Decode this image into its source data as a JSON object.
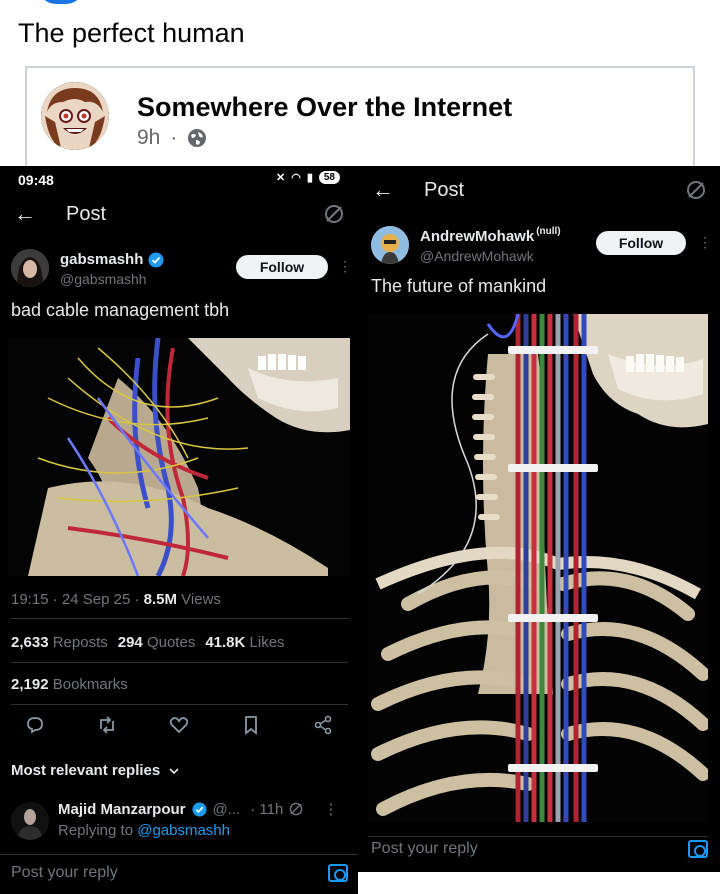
{
  "facebook": {
    "post_text": "The perfect human",
    "shared": {
      "author": "Somewhere Over the Internet",
      "time": "9h",
      "separator": "·",
      "privacy_icon": "globe-icon"
    }
  },
  "left_post": {
    "status": {
      "time": "09:48",
      "battery": "58"
    },
    "header": {
      "title": "Post",
      "back_icon": "arrow-left-icon",
      "grok_icon": "grok-icon"
    },
    "author": {
      "name": "gabsmashh",
      "handle": "@gabsmashh",
      "verified": true
    },
    "follow_label": "Follow",
    "more": "⋮",
    "text": "bad cable management tbh",
    "meta": {
      "time": "19:15",
      "date": "24 Sep 25",
      "views_count": "8.5M",
      "views_label": "Views"
    },
    "stats": {
      "reposts_count": "2,633",
      "reposts_label": "Reposts",
      "quotes_count": "294",
      "quotes_label": "Quotes",
      "likes_count": "41.8K",
      "likes_label": "Likes",
      "bookmarks_count": "2,192",
      "bookmarks_label": "Bookmarks"
    },
    "actions": [
      "reply-icon",
      "repost-icon",
      "like-icon",
      "bookmark-icon",
      "share-icon"
    ],
    "replies_sort": "Most relevant replies",
    "reply": {
      "name": "Majid Manzarpour",
      "handle": "@...",
      "time": "· 11h",
      "replying_prefix": "Replying to",
      "replying_to": "@gabsmashh"
    },
    "reply_placeholder": "Post your reply"
  },
  "right_post": {
    "header": {
      "title": "Post"
    },
    "author": {
      "name": "AndrewMohawk",
      "suffix": "(null)",
      "handle": "@AndrewMohawk"
    },
    "follow_label": "Follow",
    "more": "⋮",
    "text": "The future of mankind",
    "reply_placeholder": "Post your reply"
  },
  "colors": {
    "fb_blue": "#1b74e4",
    "x_blue": "#1d9bf0",
    "x_bg": "#000000",
    "x_text": "#e7e9ea",
    "x_dim": "#71767b"
  }
}
